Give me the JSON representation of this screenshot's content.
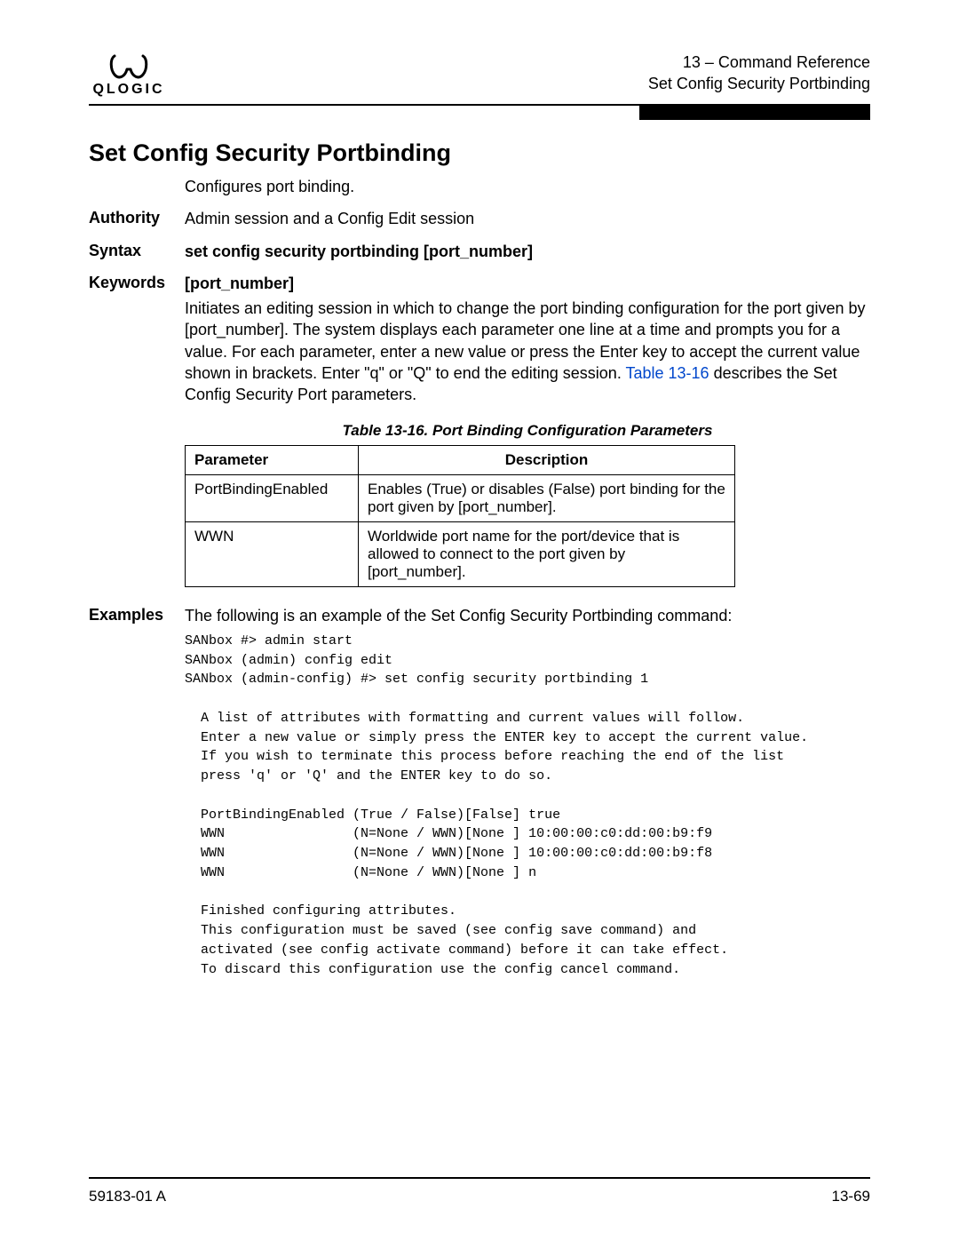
{
  "logo": {
    "wordmark": "QLOGIC"
  },
  "header": {
    "line1": "13 – Command Reference",
    "line2": "Set Config Security Portbinding"
  },
  "title": "Set Config Security Portbinding",
  "intro": "Configures port binding.",
  "authority": {
    "label": "Authority",
    "text": "Admin session and a Config Edit session"
  },
  "syntax": {
    "label": "Syntax",
    "text": "set config security portbinding [port_number]"
  },
  "keywords": {
    "label": "Keywords",
    "keyword": "[port_number]",
    "desc_part1": "Initiates an editing session in which to change the port binding configuration for the port given by [port_number]. The system displays each parameter one line at a time and prompts you for a value. For each parameter, enter a new value or press the Enter key to accept the current value shown in brackets. Enter \"q\" or \"Q\" to end the editing session. ",
    "desc_link": "Table 13-16",
    "desc_part2": " describes the Set Config Security Port parameters."
  },
  "table": {
    "caption": "Table 13-16. Port Binding Configuration Parameters",
    "headers": {
      "param": "Parameter",
      "desc": "Description"
    },
    "rows": [
      {
        "param": "PortBindingEnabled",
        "desc": "Enables (True) or disables (False) port binding for the port given by [port_number]."
      },
      {
        "param": "WWN",
        "desc": "Worldwide port name for the port/device that is allowed to connect to the port given by [port_number]."
      }
    ]
  },
  "examples": {
    "label": "Examples",
    "intro": "The following is an example of the Set Config Security Portbinding command:",
    "code": "SANbox #> admin start\nSANbox (admin) config edit\nSANbox (admin-config) #> set config security portbinding 1\n\n  A list of attributes with formatting and current values will follow.\n  Enter a new value or simply press the ENTER key to accept the current value.\n  If you wish to terminate this process before reaching the end of the list\n  press 'q' or 'Q' and the ENTER key to do so.\n\n  PortBindingEnabled (True / False)[False] true\n  WWN                (N=None / WWN)[None ] 10:00:00:c0:dd:00:b9:f9\n  WWN                (N=None / WWN)[None ] 10:00:00:c0:dd:00:b9:f8\n  WWN                (N=None / WWN)[None ] n\n\n  Finished configuring attributes.\n  This configuration must be saved (see config save command) and\n  activated (see config activate command) before it can take effect.\n  To discard this configuration use the config cancel command."
  },
  "footer": {
    "left": "59183-01 A",
    "right": "13-69"
  }
}
